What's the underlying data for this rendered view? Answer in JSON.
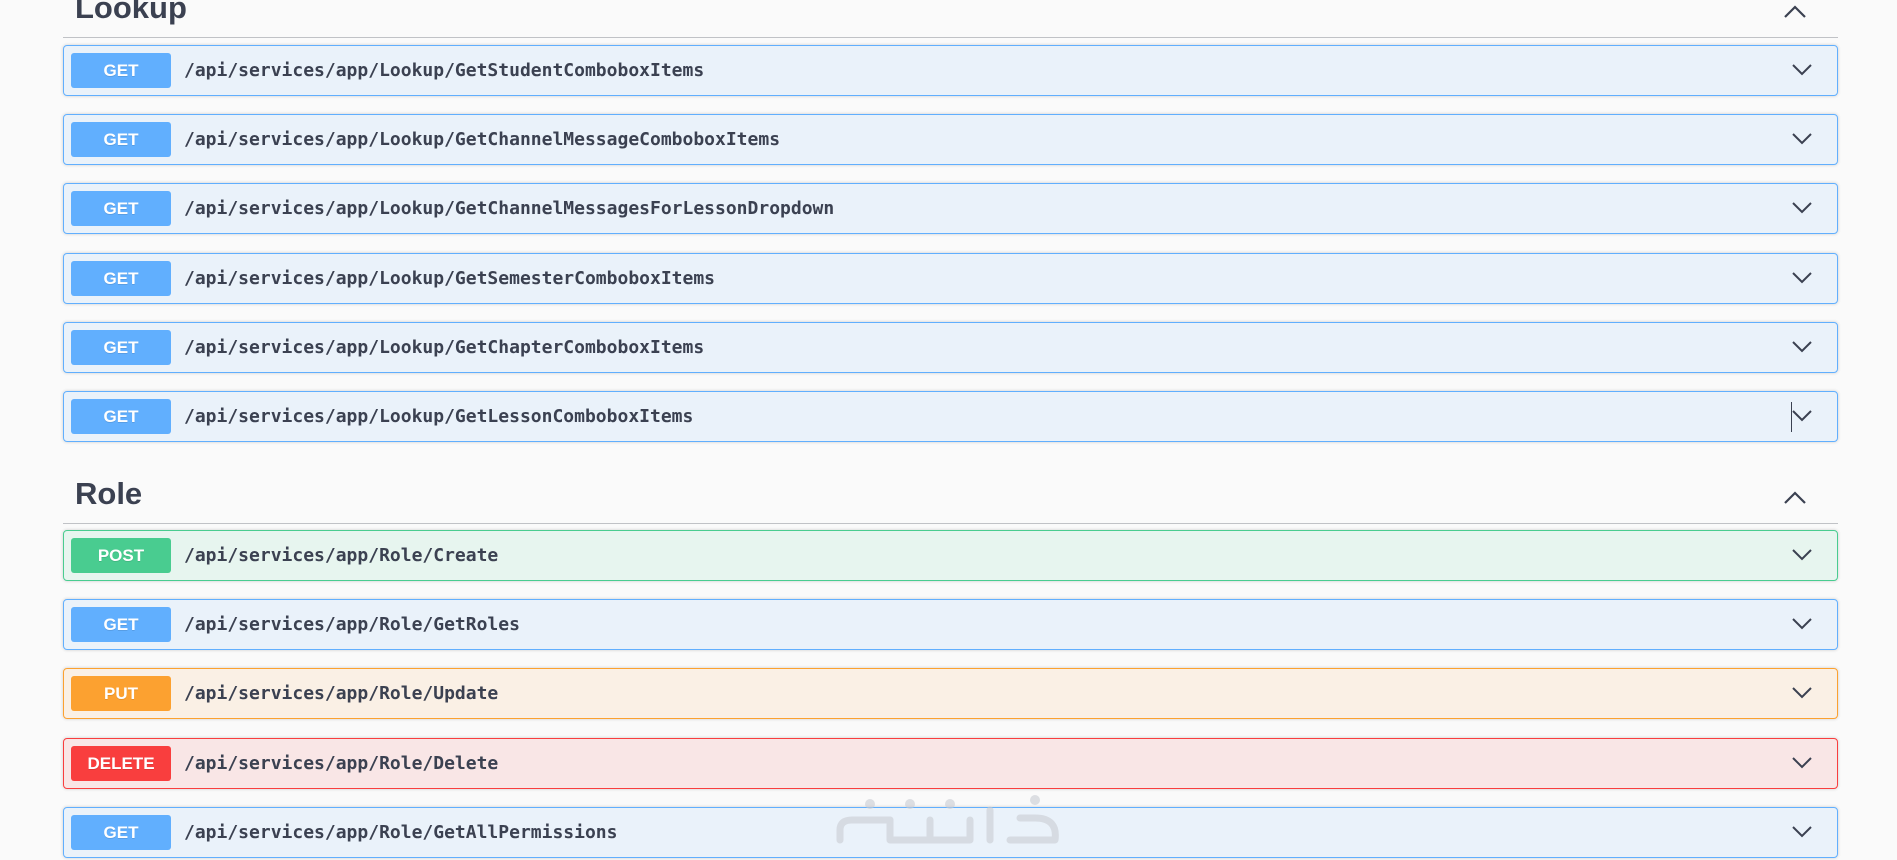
{
  "sections": [
    {
      "name": "Lookup",
      "operations": [
        {
          "method": "GET",
          "path": "/api/services/app/Lookup/GetStudentComboboxItems"
        },
        {
          "method": "GET",
          "path": "/api/services/app/Lookup/GetChannelMessageComboboxItems"
        },
        {
          "method": "GET",
          "path": "/api/services/app/Lookup/GetChannelMessagesForLessonDropdown"
        },
        {
          "method": "GET",
          "path": "/api/services/app/Lookup/GetSemesterComboboxItems"
        },
        {
          "method": "GET",
          "path": "/api/services/app/Lookup/GetChapterComboboxItems"
        },
        {
          "method": "GET",
          "path": "/api/services/app/Lookup/GetLessonComboboxItems"
        }
      ]
    },
    {
      "name": "Role",
      "operations": [
        {
          "method": "POST",
          "path": "/api/services/app/Role/Create"
        },
        {
          "method": "GET",
          "path": "/api/services/app/Role/GetRoles"
        },
        {
          "method": "PUT",
          "path": "/api/services/app/Role/Update"
        },
        {
          "method": "DELETE",
          "path": "/api/services/app/Role/Delete"
        },
        {
          "method": "GET",
          "path": "/api/services/app/Role/GetAllPermissions"
        }
      ]
    }
  ],
  "colors": {
    "get": "#61affe",
    "post": "#49cc90",
    "put": "#fca130",
    "delete": "#f93e3e",
    "text": "#3b4151"
  },
  "icons": {
    "section_toggle": "chevron-up-icon",
    "operation_toggle": "chevron-down-icon",
    "watermark": "logo-watermark"
  }
}
